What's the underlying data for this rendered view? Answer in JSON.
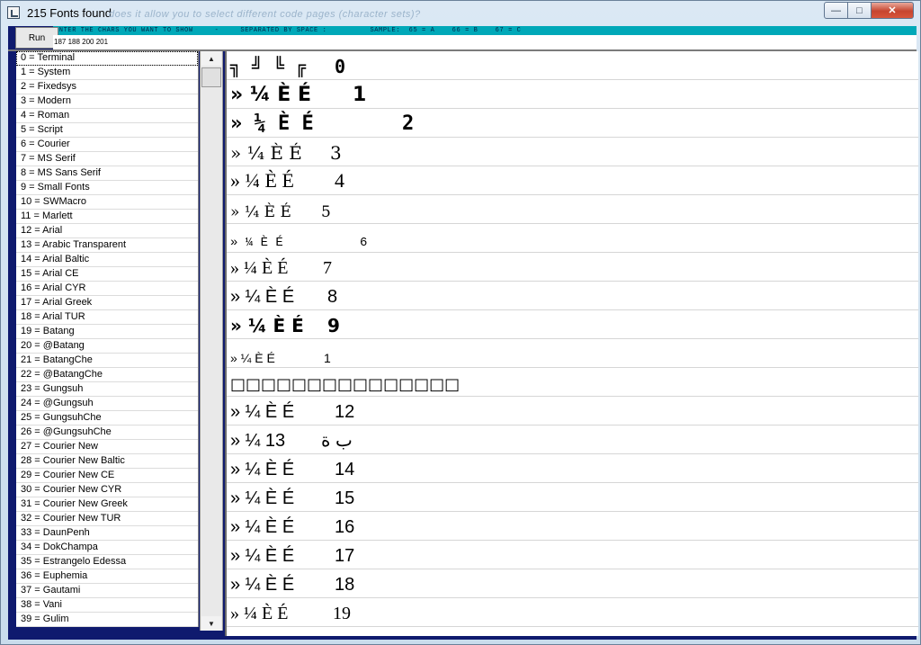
{
  "window": {
    "title": "215  Fonts  found",
    "ghost_text": "does it allow you to select different code pages (character sets)?",
    "min_icon": "minimize-icon",
    "max_icon": "maximize-icon",
    "close_icon": "close-icon",
    "min_glyph": "—",
    "max_glyph": "□",
    "close_glyph": "✕"
  },
  "toolbar": {
    "run_label": "Run",
    "instructions": "ENTER THE CHARS YOU WANT TO SHOW     -     SEPARATED BY SPACE :          SAMPLE:  65 = A    66 = B    67 = C",
    "chars_value": "187 188 200 201"
  },
  "font_list": [
    "0 = Terminal",
    "1 = System",
    "2 = Fixedsys",
    "3 = Modern",
    "4 = Roman",
    "5 = Script",
    "6 = Courier",
    "7 = MS Serif",
    "8 = MS Sans Serif",
    "9 = Small Fonts",
    "10 = SWMacro",
    "11 = Marlett",
    "12 = Arial",
    "13 = Arabic Transparent",
    "14 = Arial Baltic",
    "15 = Arial CE",
    "16 = Arial CYR",
    "17 = Arial Greek",
    "18 = Arial TUR",
    "19 = Batang",
    "20 = @Batang",
    "21 = BatangChe",
    "22 = @BatangChe",
    "23 = Gungsuh",
    "24 = @Gungsuh",
    "25 = GungsuhChe",
    "26 = @GungsuhChe",
    "27 = Courier New",
    "28 = Courier New Baltic",
    "29 = Courier New CE",
    "30 = Courier New CYR",
    "31 = Courier New Greek",
    "32 = Courier New TUR",
    "33 = DaunPenh",
    "34 = DokChampa",
    "35 = Estrangelo Edessa",
    "36 = Euphemia",
    "37 = Gautami",
    "38 = Vani",
    "39 = Gulim"
  ],
  "scrollbar": {
    "up_glyph": "▲",
    "down_glyph": "▼"
  },
  "preview_rows": [
    {
      "sample": "╗ ╝ ╚ ╔",
      "num": "0"
    },
    {
      "sample": "» ¼ È É",
      "num": "1"
    },
    {
      "sample": "» ¼ È É",
      "num": "2"
    },
    {
      "sample": "» ¼ È É",
      "num": "3"
    },
    {
      "sample": "» ¼ È É",
      "num": "4"
    },
    {
      "sample": "» ¼ È É",
      "num": "5"
    },
    {
      "sample": "» ¼ È É",
      "num": "6"
    },
    {
      "sample": "» ¼ È É",
      "num": "7"
    },
    {
      "sample": "» ¼ È É",
      "num": "8"
    },
    {
      "sample": "» ¼ È É",
      "num": "9"
    },
    {
      "sample": "» ¼ È É",
      "num": "1"
    },
    {
      "sample": "□□□□□□□□□□□□□□□",
      "num": ""
    },
    {
      "sample": "» ¼ È É",
      "num": "12"
    },
    {
      "sample": "» ¼ 13",
      "num": "ب ة"
    },
    {
      "sample": "» ¼ È É",
      "num": "14"
    },
    {
      "sample": "» ¼ È É",
      "num": "15"
    },
    {
      "sample": "» ¼ È É",
      "num": "16"
    },
    {
      "sample": "» ¼ È É",
      "num": "17"
    },
    {
      "sample": "» ¼ È É",
      "num": "18"
    },
    {
      "sample": "» ¼ È É",
      "num": "19"
    }
  ],
  "colors": {
    "client_bg": "#0f1a6e",
    "instruction_bar": "#00a8b8",
    "close_button": "#c6452f"
  }
}
